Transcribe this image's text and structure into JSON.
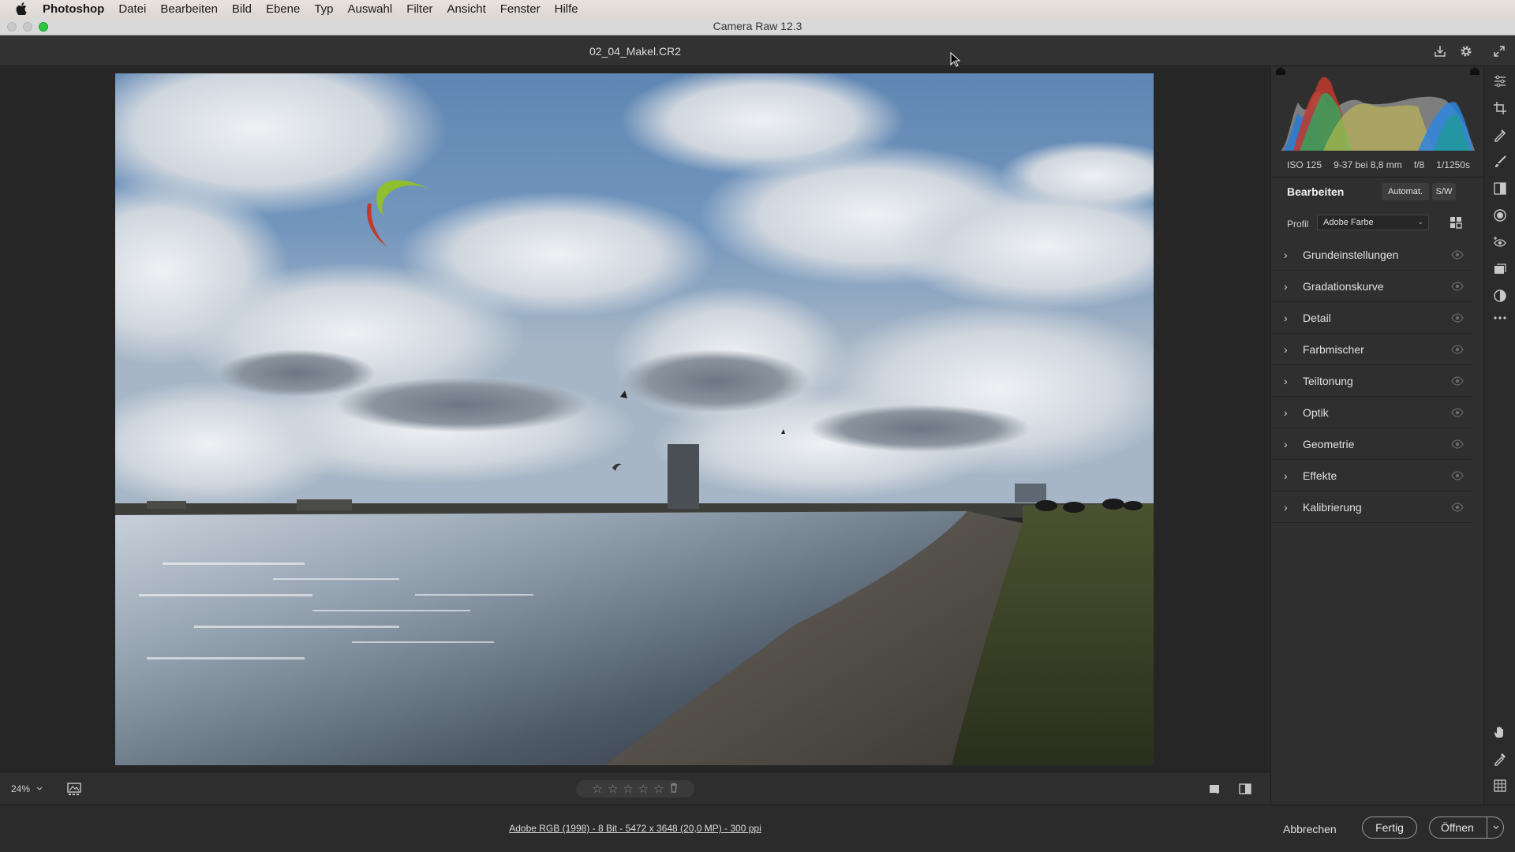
{
  "menubar": {
    "app": "Photoshop",
    "items": [
      "Datei",
      "Bearbeiten",
      "Bild",
      "Ebene",
      "Typ",
      "Auswahl",
      "Filter",
      "Ansicht",
      "Fenster",
      "Hilfe"
    ]
  },
  "window": {
    "title": "Camera Raw 12.3"
  },
  "header": {
    "filename": "02_04_Makel.CR2"
  },
  "statusbar": {
    "zoom": "24%"
  },
  "footer": {
    "image_info": "Adobe RGB (1998) - 8 Bit - 5472 x 3648 (20,0 MP) - 300 ppi",
    "cancel": "Abbrechen",
    "done": "Fertig",
    "open": "Öffnen"
  },
  "panel": {
    "exif": {
      "iso": "ISO 125",
      "lens": "9-37 bei 8,8 mm",
      "aperture": "f/8",
      "shutter": "1/1250s"
    },
    "edit_title": "Bearbeiten",
    "auto_label": "Automat.",
    "bw_label": "S/W",
    "profile_label": "Profil",
    "profile_value": "Adobe Farbe",
    "sections": [
      "Grundeinstellungen",
      "Gradationskurve",
      "Detail",
      "Farbmischer",
      "Teiltonung",
      "Optik",
      "Geometrie",
      "Effekte",
      "Kalibrierung"
    ]
  },
  "colors": {
    "accent_green": "#2bc840",
    "panel_bg": "#2f2f2f"
  }
}
